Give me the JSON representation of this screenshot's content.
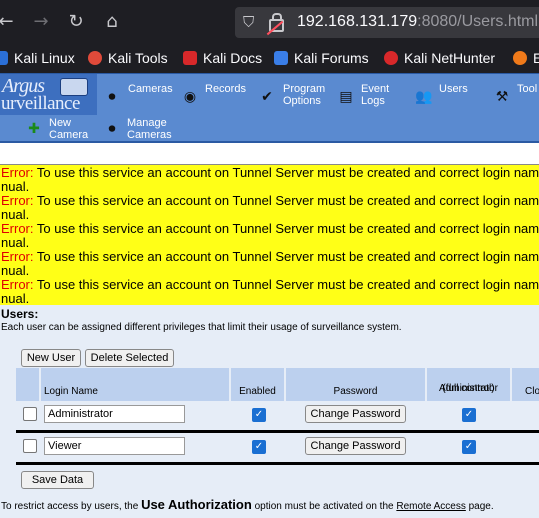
{
  "browser": {
    "url_host": "192.168.131.179",
    "url_rest": ":8080/Users.html",
    "bookmarks": [
      "Kali Linux",
      "Kali Tools",
      "Kali Docs",
      "Kali Forums",
      "Kali NetHunter",
      "E"
    ]
  },
  "logo": {
    "line1": "Argus",
    "line2": "urveillance"
  },
  "menu": {
    "cameras": "Cameras",
    "records": "Records",
    "program_options": [
      "Program",
      "Options"
    ],
    "event_logs": [
      "Event",
      "Logs"
    ],
    "users": "Users",
    "tools": "Tool"
  },
  "submenu": {
    "new_camera": [
      "New",
      "Camera"
    ],
    "manage_cameras": [
      "Manage",
      "Cameras"
    ]
  },
  "errors": {
    "label": "Error:",
    "message": "To use this service an account on Tunnel Server must be created and correct login nam",
    "tail": "nual.",
    "count_lines": [
      "1",
      "2",
      "3",
      "4",
      "5"
    ]
  },
  "users": {
    "heading": "Users:",
    "description": "Each user can be assigned different privileges that limit their usage of surveillance system.",
    "new_user": "New User",
    "delete_selected": "Delete Selected",
    "columns": {
      "login": "Login Name",
      "enabled": "Enabled",
      "password": "Password",
      "admin": [
        "Administrator",
        "(full control)"
      ],
      "clo": "Clo"
    },
    "rows": [
      {
        "login": "Administrator",
        "change_password": "Change Password"
      },
      {
        "login": "Viewer",
        "change_password": "Change Password"
      }
    ],
    "save": "Save Data"
  },
  "footer": {
    "pre": "To restrict access by users, the",
    "strong": "Use Authorization",
    "mid": "option must be activated on the",
    "link": "Remote Access",
    "post": "page."
  },
  "colors": {
    "error_bg": "#ffff17",
    "menu_bg": "#5a8ad0",
    "header_bg": "#bcd0ee",
    "panel_bg": "#e6edf7"
  }
}
